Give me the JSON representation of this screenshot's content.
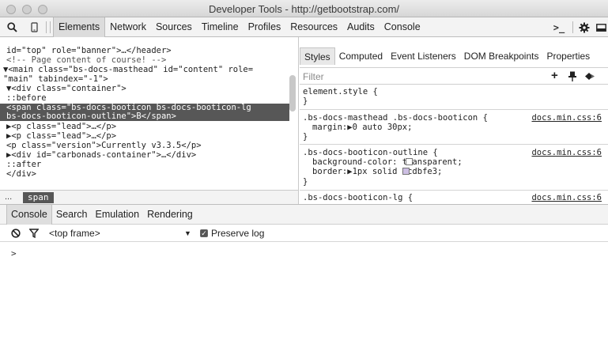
{
  "window": {
    "title": "Developer Tools - http://getbootstrap.com/"
  },
  "toolbar": {
    "icons": {
      "search": "search-icon",
      "device": "device-mode-icon",
      "drawer": "console-drawer-icon",
      "settings": "gear-icon",
      "dock": "dock-side-icon"
    },
    "drawer_glyph": ">_",
    "tabs": [
      "Elements",
      "Network",
      "Sources",
      "Timeline",
      "Profiles",
      "Resources",
      "Audits",
      "Console"
    ],
    "active_tab": "Elements"
  },
  "elements": {
    "lines": [
      "id=\"top\" role=\"banner\">…</header>",
      "  <!-- Page content of course! -->",
      "▼<main class=\"bs-docs-masthead\" id=\"content\" role=",
      "\"main\" tabindex=\"-1\">",
      "  ▼<div class=\"container\">",
      "      ::before",
      "      <span class=\"bs-docs-booticon bs-docs-booticon-lg",
      "      bs-docs-booticon-outline\">B</span>",
      "    ▶<p class=\"lead\">…</p>",
      "    ▶<p class=\"lead\">…</p>",
      "      <p class=\"version\">Currently v3.3.5</p>",
      "    ▶<div id=\"carbonads-container\">…</div>",
      "      ::after",
      "    </div>"
    ],
    "breadcrumb": {
      "ellipsis": "...",
      "current": "span"
    }
  },
  "sidebar": {
    "tabs": [
      "Styles",
      "Computed",
      "Event Listeners",
      "DOM Breakpoints",
      "Properties"
    ],
    "active_tab": "Styles",
    "filter_placeholder": "Filter",
    "filter_icons": {
      "new_rule": "add-rule-icon",
      "toggle_state": "pin-icon",
      "color_format": "color-format-icon"
    },
    "new_rule_glyph": "+",
    "rules": [
      {
        "selector": "element.style {",
        "lines": [],
        "close": "}",
        "source": ""
      },
      {
        "selector": ".bs-docs-masthead .bs-docs-booticon {",
        "lines": [
          "margin:▶0 auto 30px;"
        ],
        "close": "}",
        "source": "docs.min.css:6"
      },
      {
        "selector": ".bs-docs-booticon-outline {",
        "lines": [
          "background-color: transparent;",
          "border:▶1px solid #cdbfe3;"
        ],
        "close": "}",
        "source": "docs.min.css:6"
      },
      {
        "selector": ".bs-docs-booticon-lg {",
        "lines": [],
        "close": "",
        "source": "docs.min.css:6"
      }
    ],
    "swatch_colors": {
      "transparent": "#ffffff",
      "border": "#cdbfe3"
    }
  },
  "drawer": {
    "tabs": [
      "Console",
      "Search",
      "Emulation",
      "Rendering"
    ],
    "active_tab": "Console",
    "clear_icon": "clear-console-icon",
    "filter_icon": "filter-icon",
    "context": "<top frame>",
    "context_caret": "▼",
    "preserve_log_label": "Preserve log",
    "preserve_log_checked": true,
    "prompt": ">"
  },
  "colors": {
    "selection": "#575757",
    "toolbar_bg": "#f3f3f3"
  }
}
